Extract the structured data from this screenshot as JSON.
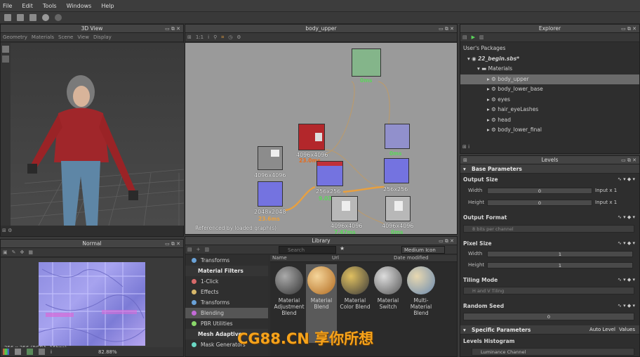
{
  "menu": [
    "File",
    "Edit",
    "Tools",
    "Windows",
    "Help"
  ],
  "view3d": {
    "title": "3D View",
    "submenu": [
      "Geometry",
      "Materials",
      "Scene",
      "View",
      "Display"
    ]
  },
  "normal_view": {
    "title": "Normal",
    "info": "256 x 256 (RGBA, 16bpc)",
    "zoom": "82.88%"
  },
  "graph": {
    "title": "body_upper",
    "status": "Referenced by loaded graph(s)",
    "nodes": [
      {
        "res": "",
        "time": "0ms"
      },
      {
        "res": "4096x4096",
        "time": "23.0ms"
      },
      {
        "res": "",
        "time": "0ms"
      },
      {
        "res": "4096x4096",
        "time": ""
      },
      {
        "res": "256x256",
        "time": "9.03ms"
      },
      {
        "res": "256x256",
        "time": ""
      },
      {
        "res": "2048x2048",
        "time": "23.6ms"
      },
      {
        "res": "4096x4096",
        "time": "7.47ms"
      },
      {
        "res": "4096x4096",
        "time": "0ms"
      }
    ]
  },
  "library": {
    "title": "Library",
    "search_placeholder": "Search",
    "view_mode": "Medium Icon",
    "columns": [
      "Name",
      "Url",
      "Date modified"
    ],
    "tree": [
      {
        "label": "Transforms",
        "type": "item",
        "color": "#6aa2d8"
      },
      {
        "label": "Material Filters",
        "type": "header"
      },
      {
        "label": "1-Click",
        "type": "item",
        "color": "#d86a6a"
      },
      {
        "label": "Effects",
        "type": "item",
        "color": "#d8b86a"
      },
      {
        "label": "Transforms",
        "type": "item",
        "color": "#6aa2d8"
      },
      {
        "label": "Blending",
        "type": "item",
        "color": "#c46ad8",
        "selected": true
      },
      {
        "label": "PBR Utilities",
        "type": "item",
        "color": "#8ad86a"
      },
      {
        "label": "Mesh Adaptive",
        "type": "header"
      },
      {
        "label": "Mask Generators",
        "type": "item",
        "color": "#6ad8c4"
      }
    ],
    "items": [
      {
        "label": "Material Adjustment Blend"
      },
      {
        "label": "Material Blend"
      },
      {
        "label": "Material Color Blend"
      },
      {
        "label": "Material Switch"
      },
      {
        "label": "Multi-Material Blend"
      }
    ]
  },
  "explorer": {
    "title": "Explorer",
    "packages_label": "User's Packages",
    "package": "22_begin.sbs*",
    "folder": "Materials",
    "graphs": [
      "body_upper",
      "body_lower_base",
      "eyes",
      "hair_eyeLashes",
      "head",
      "body_lower_final"
    ]
  },
  "levels": {
    "title": "Levels",
    "base_params": "Base Parameters",
    "output_size": "Output Size",
    "width_label": "Width",
    "height_label": "Height",
    "width_value": "0",
    "height_value": "0",
    "input_x1": "Input x 1",
    "output_format": "Output Format",
    "output_format_value": "8 bits per channel",
    "pixel_size": "Pixel Size",
    "px_width": "1",
    "px_height": "1",
    "tiling_mode": "Tiling Mode",
    "tiling_value": "H and V Tiling",
    "random_seed": "Random Seed",
    "seed_value": "0",
    "specific_params": "Specific Parameters",
    "auto_level": "Auto Level",
    "values": "Values",
    "histogram": "Levels Histogram",
    "channel": "Luminance Channel"
  },
  "watermark": "CG88.CN 享你所想"
}
